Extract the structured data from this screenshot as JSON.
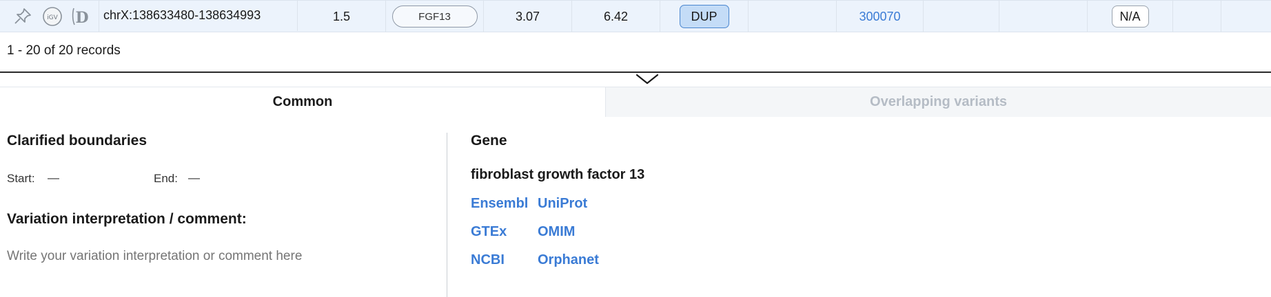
{
  "variant_row": {
    "location": "chrX:138633480-138634993",
    "size": "1.5",
    "gene": "FGF13",
    "score_a": "3.07",
    "score_b": "6.42",
    "type": "DUP",
    "omim_id": "300070",
    "status": "N/A",
    "icons": [
      "pin-icon",
      "igv-icon",
      "decipher-icon"
    ]
  },
  "records_text": "1 - 20 of 20 records",
  "tabs": [
    {
      "label": "Common",
      "active": true
    },
    {
      "label": "Overlapping variants",
      "active": false
    }
  ],
  "left_panel": {
    "title": "Clarified boundaries",
    "start_label": "Start:",
    "start_value": "—",
    "end_label": "End:",
    "end_value": "—",
    "comment_title": "Variation interpretation / comment:",
    "comment_placeholder": "Write your variation interpretation or comment here"
  },
  "right_panel": {
    "title": "Gene",
    "gene_full_name": "fibroblast growth factor 13",
    "links": [
      "Ensembl",
      "UniProt",
      "GTEx",
      "OMIM",
      "NCBI",
      "Orphanet"
    ]
  },
  "colors": {
    "link": "#3a7bd5",
    "row_bg": "#ecf3fc",
    "dup_bg": "#c4dcf7"
  }
}
